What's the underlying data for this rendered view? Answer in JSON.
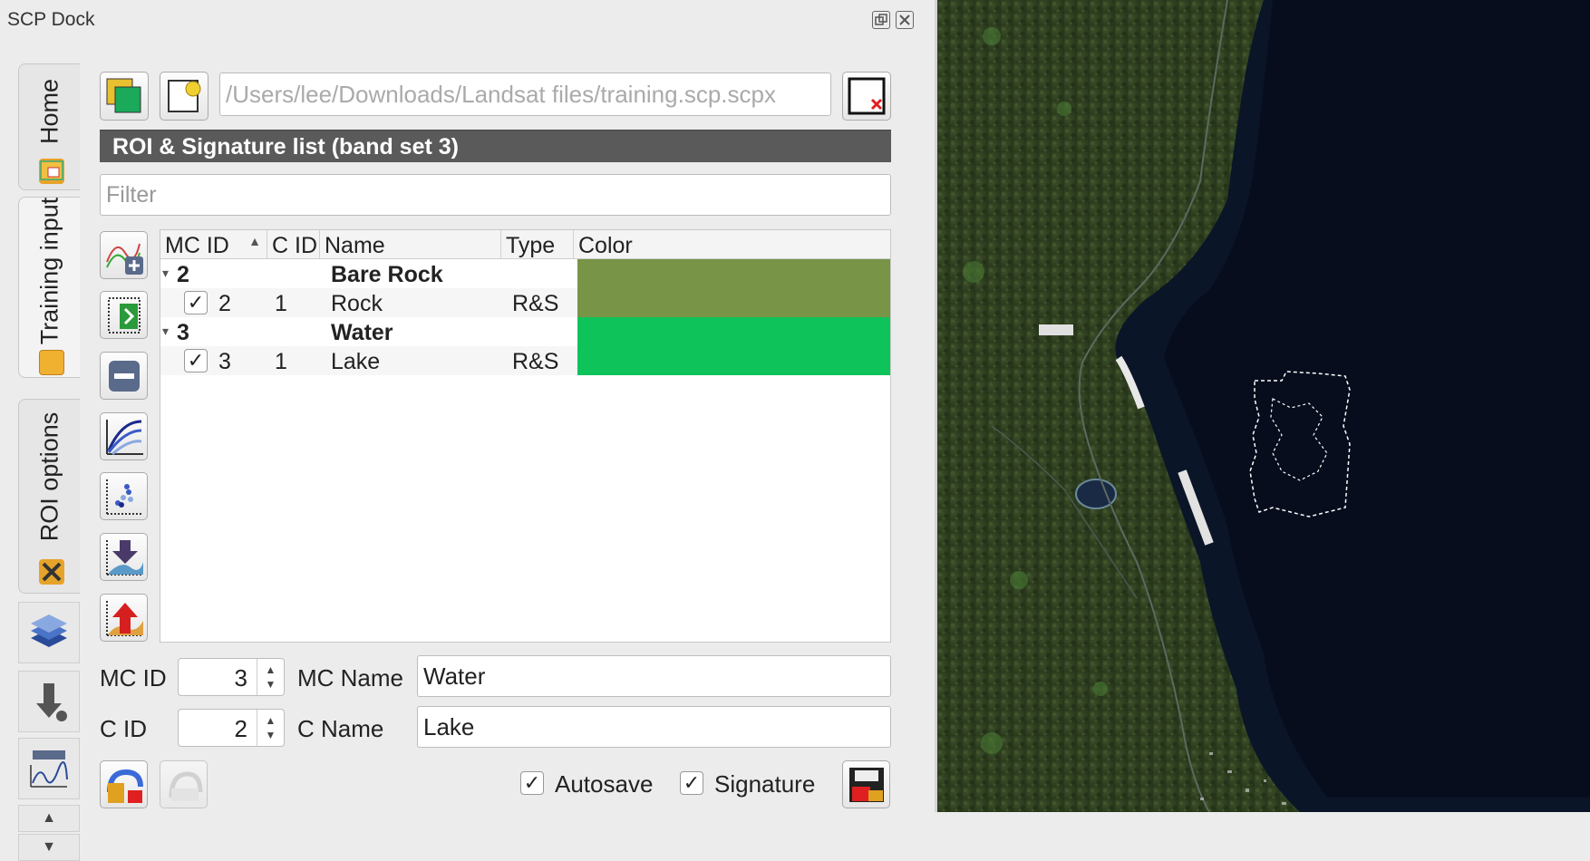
{
  "window": {
    "title": "SCP Dock",
    "float_icon": "float-icon",
    "close_icon": "close-icon"
  },
  "tabs": [
    {
      "label": "Home",
      "icon": "home-icon"
    },
    {
      "label": "Training input",
      "icon": "training-input-icon"
    },
    {
      "label": "ROI options",
      "icon": "roi-options-icon"
    }
  ],
  "side_buttons": [
    "band-set-icon",
    "download-products-icon",
    "spectral-plot-icon"
  ],
  "toolbar": {
    "path": "/Users/lee/Downloads/Landsat files/training.scp.scpx",
    "new_input_icon": "new-training-input-icon",
    "open_input_icon": "open-training-input-icon",
    "reset_icon": "reset-input-icon"
  },
  "list_header": "ROI & Signature list (band set 3)",
  "filter_placeholder": "Filter",
  "tree": {
    "columns": [
      "MC ID",
      "C ID",
      "Name",
      "Type",
      "Color"
    ],
    "groups": [
      {
        "mc_id": "2",
        "name": "Bare Rock",
        "color": "#779447",
        "children": [
          {
            "checked": "✓",
            "mc_id": "2",
            "c_id": "1",
            "name": "Rock",
            "type": "R&S",
            "color": "#779447"
          }
        ]
      },
      {
        "mc_id": "3",
        "name": "Water",
        "color": "#0ec35a",
        "children": [
          {
            "checked": "✓",
            "mc_id": "3",
            "c_id": "1",
            "name": "Lake",
            "type": "R&S",
            "color": "#0ec35a"
          }
        ]
      }
    ]
  },
  "form": {
    "mc_id_label": "MC ID",
    "mc_id_value": "3",
    "mc_name_label": "MC Name",
    "mc_name_value": "Water",
    "c_id_label": "C ID",
    "c_id_value": "2",
    "c_name_label": "C Name",
    "c_name_value": "Lake"
  },
  "bottom": {
    "autosave_label": "Autosave",
    "autosave_checked": "✓",
    "signature_label": "Signature",
    "signature_checked": "✓"
  }
}
